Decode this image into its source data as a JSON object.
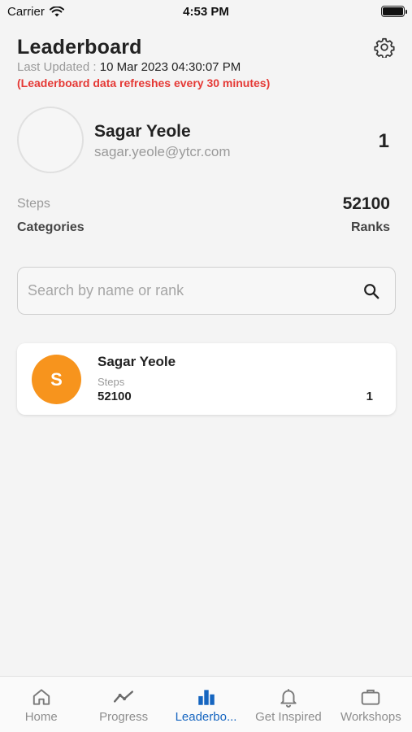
{
  "status_bar": {
    "carrier": "Carrier",
    "time": "4:53 PM"
  },
  "header": {
    "title": "Leaderboard",
    "last_updated_label": "Last Updated :",
    "last_updated_value": "10 Mar 2023 04:30:07 PM",
    "refresh_note": "(Leaderboard data refreshes every 30 minutes)"
  },
  "profile": {
    "name": "Sagar Yeole",
    "email": "sagar.yeole@ytcr.com",
    "rank": "1"
  },
  "stats": {
    "steps_label": "Steps",
    "steps_value": "52100",
    "categories_label": "Categories",
    "ranks_label": "Ranks"
  },
  "search": {
    "placeholder": "Search by name or rank",
    "value": ""
  },
  "leaderboard": [
    {
      "initial": "S",
      "name": "Sagar Yeole",
      "metric_label": "Steps",
      "metric_value": "52100",
      "rank": "1",
      "avatar_color": "#f7941d"
    }
  ],
  "tabs": [
    {
      "label": "Home",
      "icon": "home-icon"
    },
    {
      "label": "Progress",
      "icon": "progress-chart-icon"
    },
    {
      "label": "Leaderbo...",
      "icon": "leaderboard-bars-icon",
      "active": true
    },
    {
      "label": "Get Inspired",
      "icon": "bell-icon"
    },
    {
      "label": "Workshops",
      "icon": "briefcase-icon"
    }
  ],
  "colors": {
    "accent": "#1565c0",
    "alert": "#e53935",
    "avatar": "#f7941d"
  }
}
